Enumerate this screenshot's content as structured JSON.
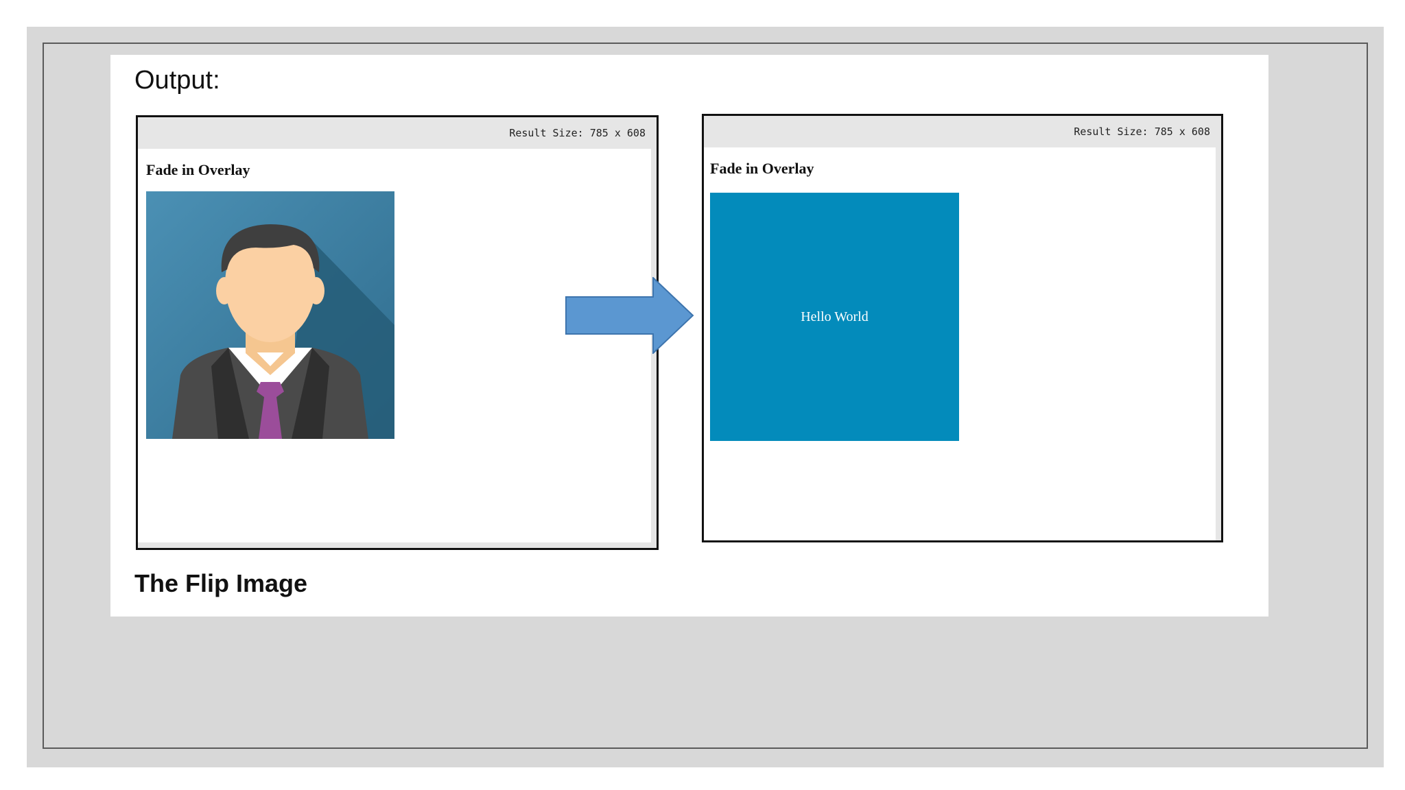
{
  "slide": {
    "output_label": "Output:",
    "section_title": "The Flip Image"
  },
  "left_panel": {
    "result_size": "Result Size: 785 x 608",
    "heading": "Fade in Overlay",
    "image_icon": "businessman-avatar-icon"
  },
  "right_panel": {
    "result_size": "Result Size: 785 x 608",
    "heading": "Fade in Overlay",
    "overlay_text": "Hello World"
  },
  "arrow_icon": "right-arrow-icon",
  "colors": {
    "frame_gray": "#d8d8d8",
    "overlay_blue": "#038bbb",
    "arrow_blue": "#5b97d1",
    "avatar_bg": "#3c7ea0",
    "tie_purple": "#9b4d9a"
  }
}
